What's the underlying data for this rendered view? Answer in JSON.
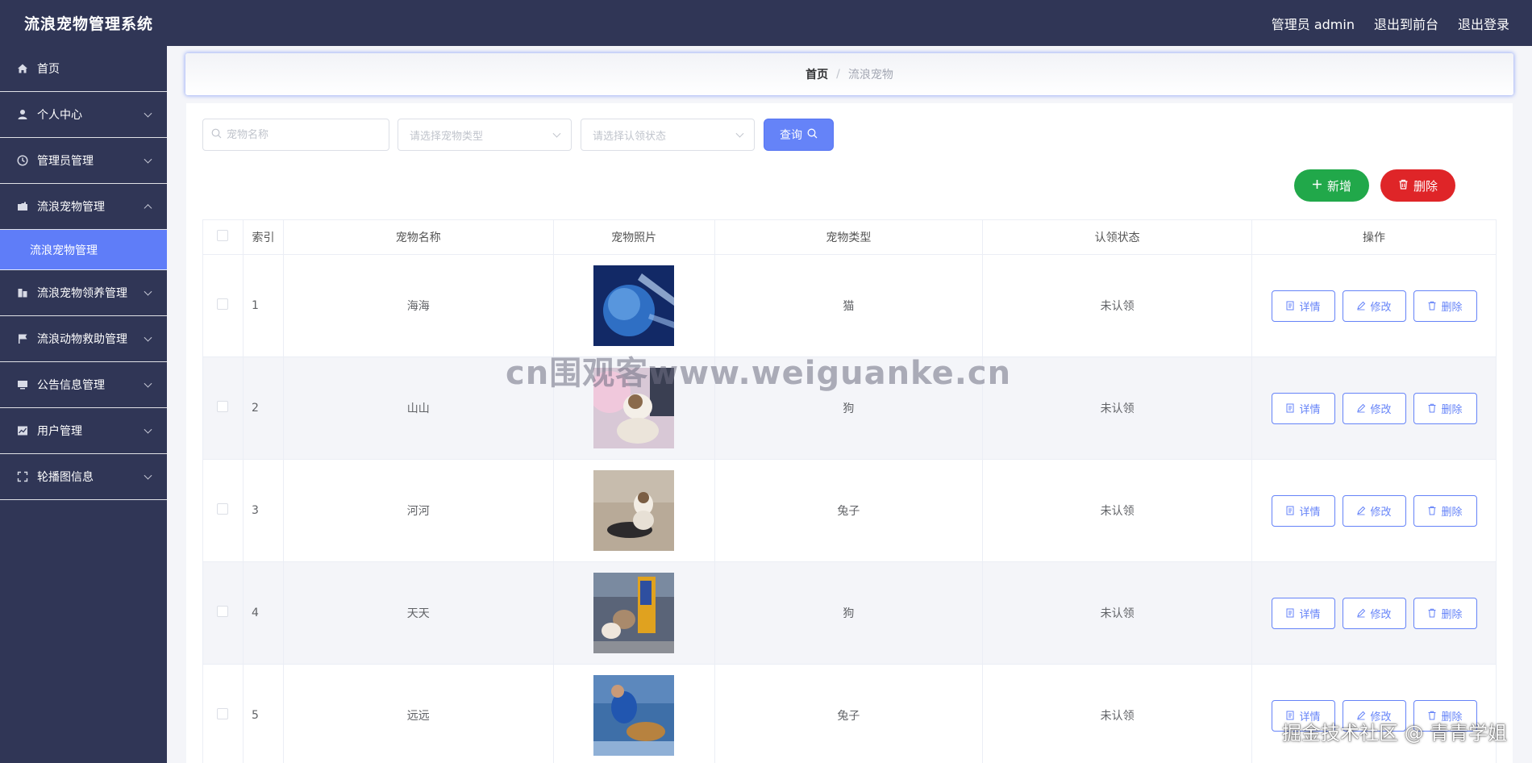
{
  "header": {
    "title": "流浪宠物管理系统",
    "admin_label": "管理员 admin",
    "to_front_label": "退出到前台",
    "logout_label": "退出登录"
  },
  "sidebar": {
    "items": [
      {
        "label": "首页",
        "icon": "home-icon"
      },
      {
        "label": "个人中心",
        "icon": "user-icon"
      },
      {
        "label": "管理员管理",
        "icon": "clock-icon"
      },
      {
        "label": "流浪宠物管理",
        "icon": "folder-icon",
        "expanded": true
      },
      {
        "label": "流浪宠物领养管理",
        "icon": "building-icon"
      },
      {
        "label": "流浪动物救助管理",
        "icon": "flag-icon"
      },
      {
        "label": "公告信息管理",
        "icon": "monitor-icon"
      },
      {
        "label": "用户管理",
        "icon": "chart-icon"
      },
      {
        "label": "轮播图信息",
        "icon": "fullscreen-icon"
      }
    ],
    "sub_active": "流浪宠物管理"
  },
  "breadcrumb": {
    "home": "首页",
    "separator": "/",
    "current": "流浪宠物"
  },
  "filters": {
    "name_placeholder": "宠物名称",
    "type_placeholder": "请选择宠物类型",
    "status_placeholder": "请选择认领状态",
    "query_label": "查询"
  },
  "actions": {
    "add_label": "新增",
    "delete_label": "删除"
  },
  "table": {
    "columns": [
      "索引",
      "宠物名称",
      "宠物照片",
      "宠物类型",
      "认领状态",
      "操作"
    ],
    "ops": {
      "detail": "详情",
      "edit": "修改",
      "delete": "删除"
    },
    "rows": [
      {
        "index": "1",
        "name": "海海",
        "type": "猫",
        "status": "未认领"
      },
      {
        "index": "2",
        "name": "山山",
        "type": "狗",
        "status": "未认领"
      },
      {
        "index": "3",
        "name": "河河",
        "type": "兔子",
        "status": "未认领"
      },
      {
        "index": "4",
        "name": "天天",
        "type": "狗",
        "status": "未认领"
      },
      {
        "index": "5",
        "name": "远远",
        "type": "兔子",
        "status": "未认领"
      }
    ]
  },
  "watermarks": {
    "center": "cn围观客www.weiguanke.cn",
    "corner": "掘金技术社区 @ 青青学姐"
  },
  "colors": {
    "nav_bg": "#303656",
    "accent": "#5f7df8",
    "add_green": "#21a84a",
    "delete_red": "#df2528"
  }
}
